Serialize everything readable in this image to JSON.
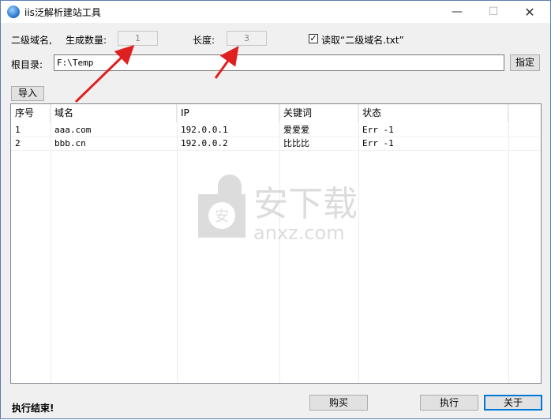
{
  "window": {
    "title": "iis泛解析建站工具",
    "min_symbol": "—",
    "max_symbol": "☐",
    "close_symbol": "✕"
  },
  "form": {
    "subdomain_label": "二级域名,",
    "count_label": "生成数量:",
    "count_value": "1",
    "length_label": "长度:",
    "length_value": "3",
    "read_checkbox_label": "读取“二级域名.txt”",
    "read_checkbox_checked": true,
    "root_label": "根目录:",
    "root_value": "F:\\Temp",
    "specify_button": "指定",
    "import_button": "导入"
  },
  "table": {
    "columns": [
      "序号",
      "域名",
      "IP",
      "关键词",
      "状态"
    ],
    "rows": [
      [
        "1",
        "aaa.com",
        "192.0.0.1",
        "爱爱爱",
        "Err -1"
      ],
      [
        "2",
        "bbb.cn",
        "192.0.0.2",
        "比比比",
        "Err -1"
      ]
    ]
  },
  "watermark": {
    "brand": "安下载",
    "domain": "anxz.com"
  },
  "footer": {
    "status_text": "执行结束!",
    "buy_button": "购买",
    "execute_button": "执行",
    "about_button": "关于"
  },
  "colors": {
    "annotation_arrow": "#e02020",
    "focus_border": "#0078d7"
  }
}
